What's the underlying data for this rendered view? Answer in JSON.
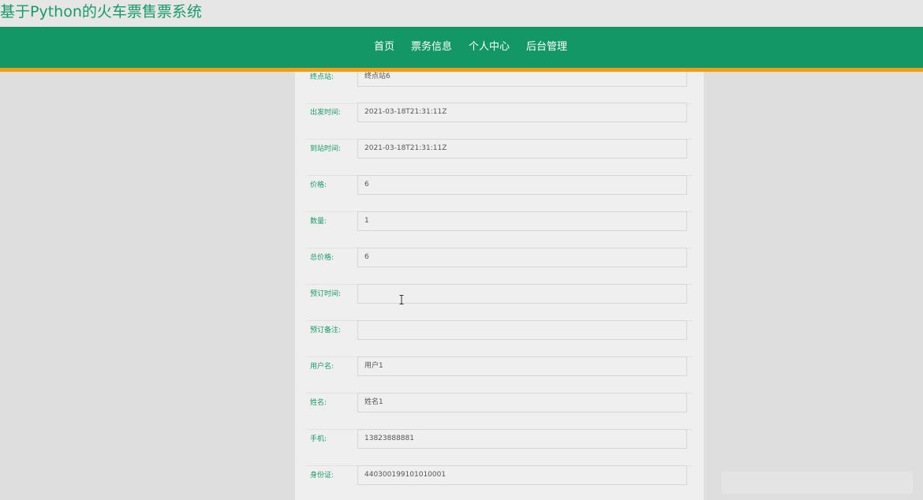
{
  "site": {
    "title": "基于Python的火车票售票系统"
  },
  "nav": {
    "items": [
      {
        "label": "首页"
      },
      {
        "label": "票务信息"
      },
      {
        "label": "个人中心"
      },
      {
        "label": "后台管理"
      }
    ]
  },
  "colors": {
    "brand_green": "#149766",
    "accent_orange": "#f39c12",
    "label_green": "#169b68"
  },
  "form": {
    "fields": [
      {
        "label": "终点站:",
        "value": "终点站6"
      },
      {
        "label": "出发时间:",
        "value": "2021-03-18T21:31:11Z"
      },
      {
        "label": "到站时间:",
        "value": "2021-03-18T21:31:11Z"
      },
      {
        "label": "价格:",
        "value": "6"
      },
      {
        "label": "数量:",
        "value": "1"
      },
      {
        "label": "总价格:",
        "value": "6"
      },
      {
        "label": "预订时间:",
        "value": ""
      },
      {
        "label": "预订备注:",
        "value": ""
      },
      {
        "label": "用户名:",
        "value": "用户1"
      },
      {
        "label": "姓名:",
        "value": "姓名1"
      },
      {
        "label": "手机:",
        "value": "13823888881"
      },
      {
        "label": "身份证:",
        "value": "440300199101010001"
      }
    ]
  },
  "cursor": {
    "icon": "text-cursor-icon"
  }
}
